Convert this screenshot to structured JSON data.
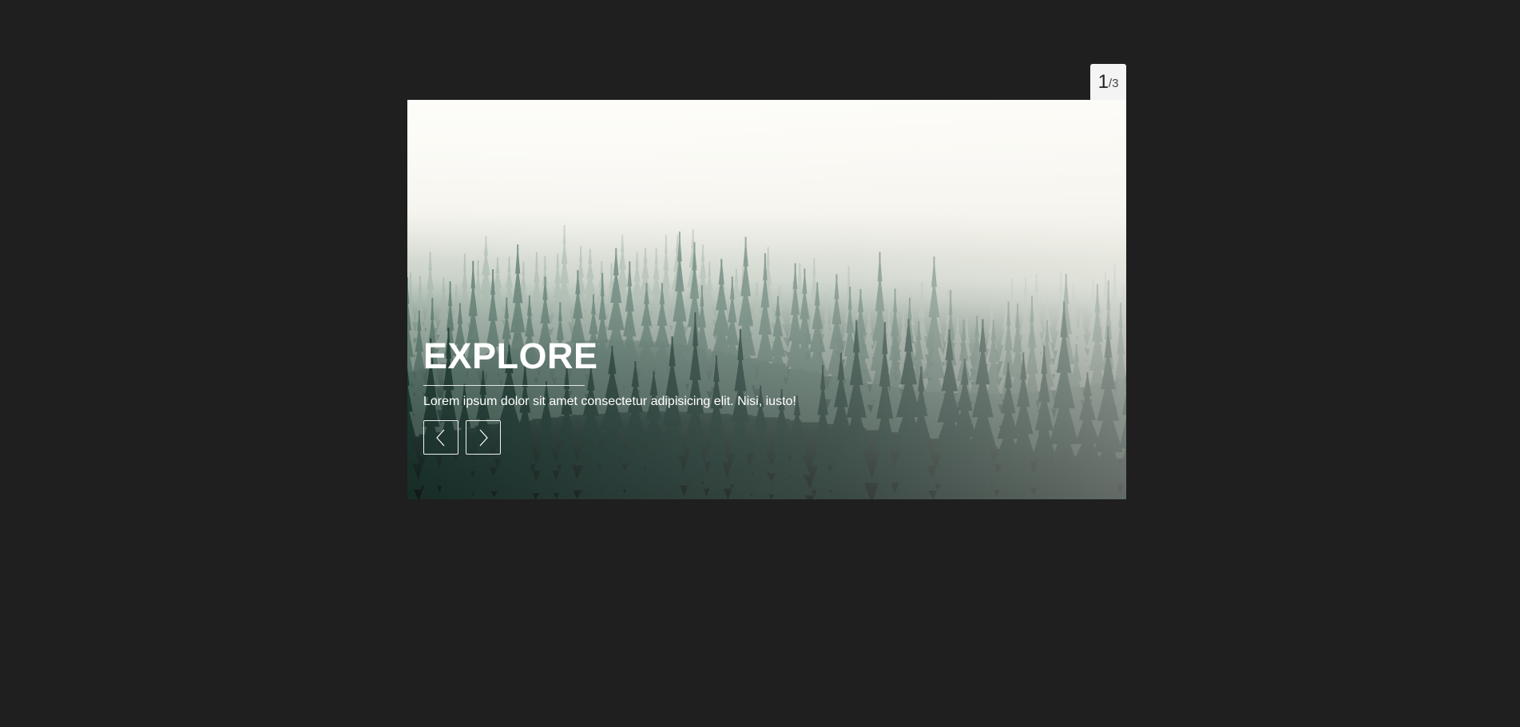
{
  "slider": {
    "counter": {
      "current": "1",
      "separator": "/",
      "total": "3"
    },
    "slide": {
      "title": "EXPLORE",
      "text": "Lorem ipsum dolor sit amet consectetur adipisicing elit. Nisi, iusto!",
      "image_icon": "misty-forest-image"
    },
    "nav": {
      "prev_icon": "chevron-left-icon",
      "next_icon": "chevron-right-icon"
    }
  },
  "colors": {
    "background": "#1f1f1f",
    "counter_bg": "#f4f4f4",
    "caption_text": "#ffffff"
  }
}
